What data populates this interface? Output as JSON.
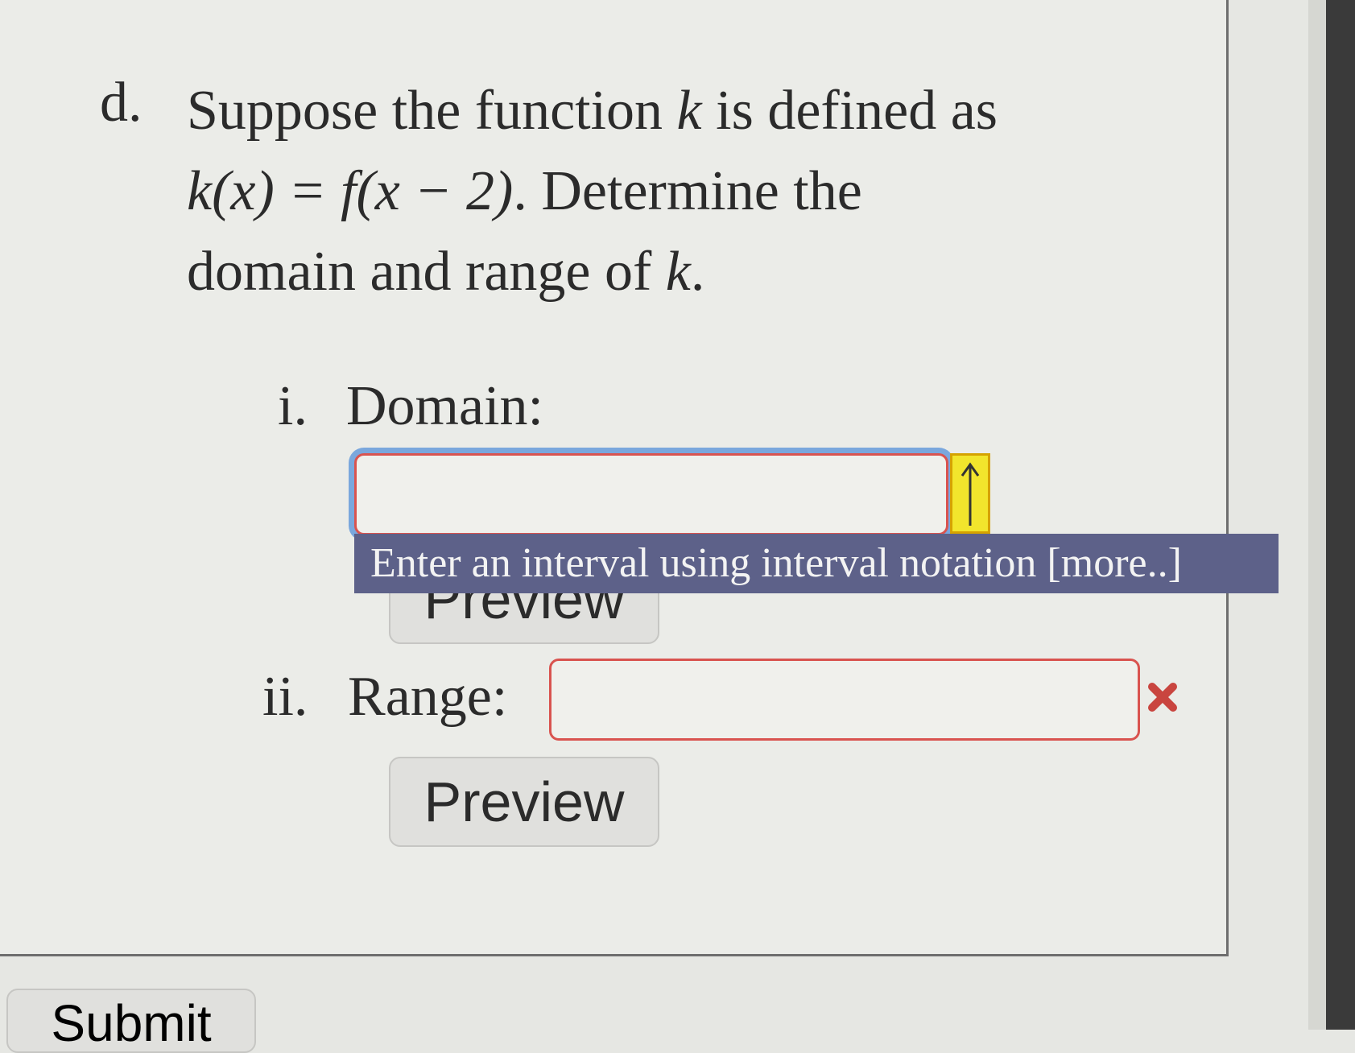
{
  "question": {
    "marker": "d.",
    "line1_prefix": "Suppose the function ",
    "var_k": "k",
    "line1_suffix": " is defined as",
    "formula": "k(x) = f(x − 2)",
    "line2_suffix": ". Determine the",
    "line3_prefix": "domain and range of ",
    "line3_suffix": "."
  },
  "domain": {
    "marker": "i.",
    "label": "Domain:",
    "value": "",
    "placeholder": "",
    "arrow_icon": "up-arrow-icon",
    "tooltip": "Enter an interval using interval notation [more..]",
    "preview_label": "Preview"
  },
  "range": {
    "marker": "ii.",
    "label": "Range:",
    "value": "",
    "placeholder": "",
    "error_icon": "x-mark-icon",
    "preview_label": "Preview"
  },
  "submit_label": "Submit",
  "colors": {
    "error_border": "#d9534f",
    "focus_ring": "#7aa7dd",
    "tooltip_bg": "#5d6189",
    "arrow_button": "#f2e52c"
  }
}
